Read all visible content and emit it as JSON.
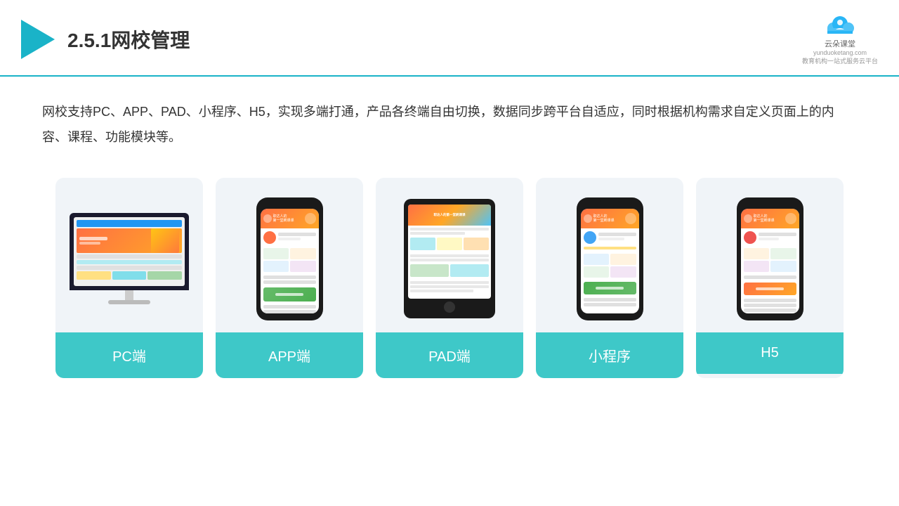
{
  "header": {
    "title": "2.5.1网校管理",
    "brand": {
      "name": "云朵课堂",
      "url": "yunduoketang.com",
      "tagline": "教育机构一站式服务云平台"
    }
  },
  "description": "网校支持PC、APP、PAD、小程序、H5，实现多端打通，产品各终端自由切换，数据同步跨平台自适应，同时根据机构需求自定义页面上的内容、课程、功能模块等。",
  "cards": [
    {
      "id": "pc",
      "label": "PC端"
    },
    {
      "id": "app",
      "label": "APP端"
    },
    {
      "id": "pad",
      "label": "PAD端"
    },
    {
      "id": "miniprogram",
      "label": "小程序"
    },
    {
      "id": "h5",
      "label": "H5"
    }
  ],
  "colors": {
    "teal": "#3ec8c8",
    "header_border": "#1ab3c8",
    "triangle": "#1ab3c8",
    "background": "#ffffff",
    "card_bg": "#f0f4f8"
  }
}
